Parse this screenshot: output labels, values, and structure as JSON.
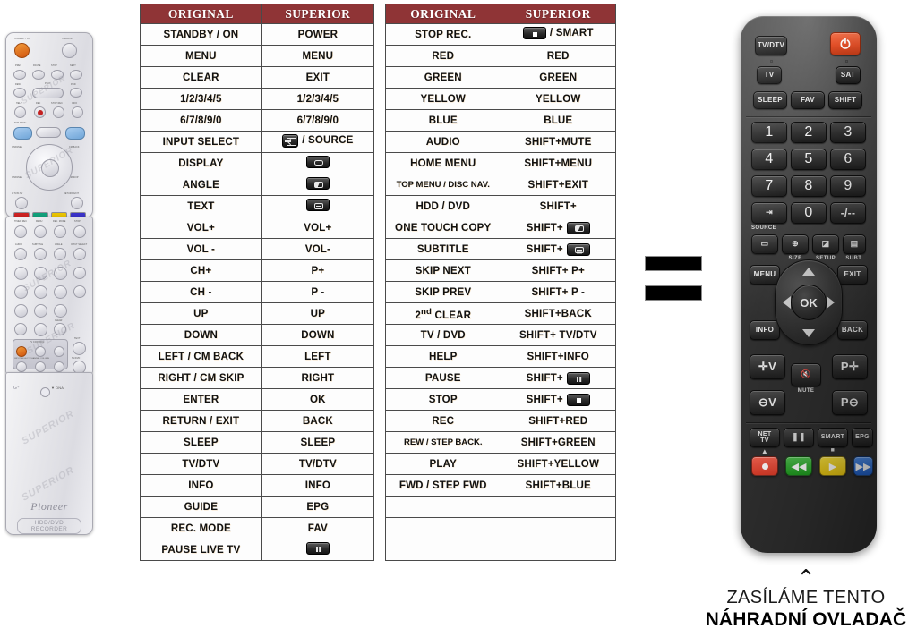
{
  "tables": [
    {
      "id": "table-1",
      "headers": [
        "ORIGINAL",
        "SUPERIOR"
      ],
      "rows": [
        {
          "original": "STANDBY / ON",
          "superior": "POWER"
        },
        {
          "original": "MENU",
          "superior": "MENU"
        },
        {
          "original": "CLEAR",
          "superior": "EXIT"
        },
        {
          "original": "1/2/3/4/5",
          "superior": "1/2/3/4/5"
        },
        {
          "original": "6/7/8/9/0",
          "superior": "6/7/8/9/0"
        },
        {
          "original": "INPUT SELECT",
          "superior": "/ SOURCE",
          "superior_icon": "source-key-icon",
          "icon_pos": "before"
        },
        {
          "original": "DISPLAY",
          "superior": "",
          "superior_icon": "display-key-icon"
        },
        {
          "original": "ANGLE",
          "superior": "",
          "superior_icon": "setup-key-icon"
        },
        {
          "original": "TEXT",
          "superior": "",
          "superior_icon": "subtitle-key-icon"
        },
        {
          "original": "VOL+",
          "superior": "VOL+"
        },
        {
          "original": "VOL -",
          "superior": "VOL-"
        },
        {
          "original": "CH+",
          "superior": "P+"
        },
        {
          "original": "CH -",
          "superior": "P -"
        },
        {
          "original": "UP",
          "superior": "UP"
        },
        {
          "original": "DOWN",
          "superior": "DOWN"
        },
        {
          "original": "LEFT / CM BACK",
          "superior": "LEFT"
        },
        {
          "original": "RIGHT / CM SKIP",
          "superior": "RIGHT"
        },
        {
          "original": "ENTER",
          "superior": "OK"
        },
        {
          "original": "RETURN / EXIT",
          "superior": "BACK"
        },
        {
          "original": "SLEEP",
          "superior": "SLEEP"
        },
        {
          "original": "TV/DTV",
          "superior": "TV/DTV"
        },
        {
          "original": "INFO",
          "superior": "INFO"
        },
        {
          "original": "GUIDE",
          "superior": "EPG"
        },
        {
          "original": "REC. MODE",
          "superior": "FAV"
        },
        {
          "original": "PAUSE LIVE TV",
          "superior": "",
          "superior_icon": "pause-key-icon"
        }
      ]
    },
    {
      "id": "table-2",
      "headers": [
        "ORIGINAL",
        "SUPERIOR"
      ],
      "rows": [
        {
          "original": "STOP REC.",
          "superior": "/ SMART",
          "superior_icon": "stop-key-icon",
          "icon_pos": "before"
        },
        {
          "original": "RED",
          "superior": "RED"
        },
        {
          "original": "GREEN",
          "superior": "GREEN"
        },
        {
          "original": "YELLOW",
          "superior": "YELLOW"
        },
        {
          "original": "BLUE",
          "superior": "BLUE"
        },
        {
          "original": "AUDIO",
          "superior": "SHIFT+MUTE"
        },
        {
          "original": "HOME MENU",
          "superior": "SHIFT+MENU"
        },
        {
          "original": "TOP MENU / DISC NAV.",
          "superior": "SHIFT+EXIT",
          "small": true
        },
        {
          "original": "HDD / DVD",
          "superior": "SHIFT+"
        },
        {
          "original": "ONE TOUCH COPY",
          "superior": "SHIFT+",
          "superior_icon": "setup-key-icon"
        },
        {
          "original": "SUBTITLE",
          "superior": "SHIFT+",
          "superior_icon": "subtitle-key-icon"
        },
        {
          "original": "SKIP NEXT",
          "superior": "SHIFT+ P+"
        },
        {
          "original": "SKIP PREV",
          "superior": "SHIFT+ P -"
        },
        {
          "original": "2nd CLEAR",
          "superior": "SHIFT+BACK",
          "sup_html": "2<sup>nd</sup> CLEAR"
        },
        {
          "original": "TV / DVD",
          "superior": "SHIFT+ TV/DTV"
        },
        {
          "original": "HELP",
          "superior": "SHIFT+INFO"
        },
        {
          "original": "PAUSE",
          "superior": "SHIFT+",
          "superior_icon": "pause-key-icon"
        },
        {
          "original": "STOP",
          "superior": "SHIFT+",
          "superior_icon": "stop-key-icon"
        },
        {
          "original": "REC",
          "superior": "SHIFT+RED"
        },
        {
          "original": "REW / STEP BACK.",
          "superior": "SHIFT+GREEN",
          "small": true
        },
        {
          "original": "PLAY",
          "superior": "SHIFT+YELLOW"
        },
        {
          "original": "FWD / STEP FWD",
          "superior": "SHIFT+BLUE"
        },
        {
          "original": "",
          "superior": ""
        },
        {
          "original": "",
          "superior": ""
        },
        {
          "original": "",
          "superior": ""
        }
      ]
    }
  ],
  "equals": {
    "name": "equals-sign"
  },
  "original_remotes": {
    "brand": "Pioneer",
    "model_label": "HDD/DVD RECORDER",
    "watermark": "SUPERIOR",
    "top_remote": {
      "keys": [
        {
          "label": "STANDBY / ON"
        },
        {
          "label": "HDD/DVD"
        },
        {
          "label": "PREV"
        },
        {
          "label": "PAUSE"
        },
        {
          "label": "STOP"
        },
        {
          "label": "NEXT"
        },
        {
          "label": "REW"
        },
        {
          "label": "PLAY"
        },
        {
          "label": "FWD"
        },
        {
          "label": "HELP"
        },
        {
          "label": "REC"
        },
        {
          "label": "STOP REC"
        },
        {
          "label": "INFO"
        },
        {
          "label": "TOP MENU"
        },
        {
          "label": "DISC NAV."
        },
        {
          "label": "GUIDE"
        },
        {
          "label": "CHANNEL"
        },
        {
          "label": "CM BACK"
        },
        {
          "label": "ENTER"
        },
        {
          "label": "CM SKIP"
        },
        {
          "label": "A.TV/D.TV"
        },
        {
          "label": "RETURN/EXIT"
        }
      ],
      "color_keys": [
        "RED",
        "GREEN",
        "YELLOW",
        "BLUE"
      ]
    },
    "bottom_remote": {
      "keys": [
        {
          "label": "TIMER REC"
        },
        {
          "label": "MENU"
        },
        {
          "label": "REC. MODE"
        },
        {
          "label": "STOP"
        },
        {
          "label": "AUDIO"
        },
        {
          "label": "SUBTITLE"
        },
        {
          "label": "ANGLE"
        },
        {
          "label": "INPUT SELECT"
        },
        {
          "label": "1"
        },
        {
          "label": "2"
        },
        {
          "label": "3"
        },
        {
          "label": "CMSKIP"
        },
        {
          "label": "4"
        },
        {
          "label": "5"
        },
        {
          "label": "6"
        },
        {
          "label": "DISPLAY"
        },
        {
          "label": "7"
        },
        {
          "label": "8"
        },
        {
          "label": "9"
        },
        {
          "label": "0"
        },
        {
          "label": "CLEAR"
        },
        {
          "label": "TEXT"
        },
        {
          "label": "TV/DVD"
        }
      ],
      "tv_control": {
        "title": "TV CONTROL",
        "labels": [
          "INPUT SELECT",
          "CHANNEL",
          "VOLUME"
        ]
      }
    }
  },
  "superior_remote": {
    "name": "superior-remote",
    "power_color": "#e24f28",
    "rows": {
      "r1": [
        "TV/DTV",
        "POWER"
      ],
      "r2": [
        "TV",
        "SAT"
      ],
      "r3": [
        "SLEEP",
        "FAV",
        "SHIFT"
      ],
      "numpad": [
        "1",
        "2",
        "3",
        "4",
        "5",
        "6",
        "7",
        "8",
        "9"
      ],
      "r7": [
        "SOURCE",
        "0",
        "-/--"
      ],
      "r8": [
        "DISPLAY",
        "SIZE",
        "SETUP",
        "SUBT."
      ],
      "nav_side": [
        "MENU",
        "EXIT",
        "INFO",
        "BACK"
      ],
      "nav": [
        "UP",
        "LEFT",
        "OK",
        "RIGHT",
        "DOWN"
      ],
      "vol_prog": [
        "V+",
        "P+",
        "MUTE",
        "V-",
        "P-"
      ],
      "r12": [
        "NET TV",
        "PAUSE",
        "SMART",
        "EPG"
      ],
      "color_row": [
        "RECORD",
        "REWIND",
        "PLAY",
        "FORWARD"
      ]
    },
    "labels": {
      "tvdtv": "TV/DTV",
      "tv": "TV",
      "sat": "SAT",
      "sleep": "SLEEP",
      "fav": "FAV",
      "shift": "SHIFT",
      "source": "SOURCE",
      "zero": "0",
      "dash": "-/--",
      "size": "SIZE",
      "setup": "SETUP",
      "subt": "SUBT.",
      "menu": "MENU",
      "exit": "EXIT",
      "info": "INFO",
      "back": "BACK",
      "ok": "OK",
      "mute": "MUTE",
      "volup": "V",
      "voldn": "V",
      "pup": "P",
      "pdn": "P",
      "nettv": "NET\nTV",
      "smart": "SMART",
      "epg": "EPG"
    }
  },
  "caption": {
    "chevron": "⌃",
    "line1": "ZASÍLÁME TENTO",
    "line2": "NÁHRADNÍ OVLADAČ"
  },
  "colors": {
    "table_header_bg": "#8f3436",
    "table_border": "#4a4a4a",
    "cell_bg": "#fdfdfd",
    "power_red": "#e24f28",
    "record_red": "#d93b28",
    "green": "#1f9a1f",
    "yellow": "#e8c511",
    "blue": "#1f5fc8"
  }
}
